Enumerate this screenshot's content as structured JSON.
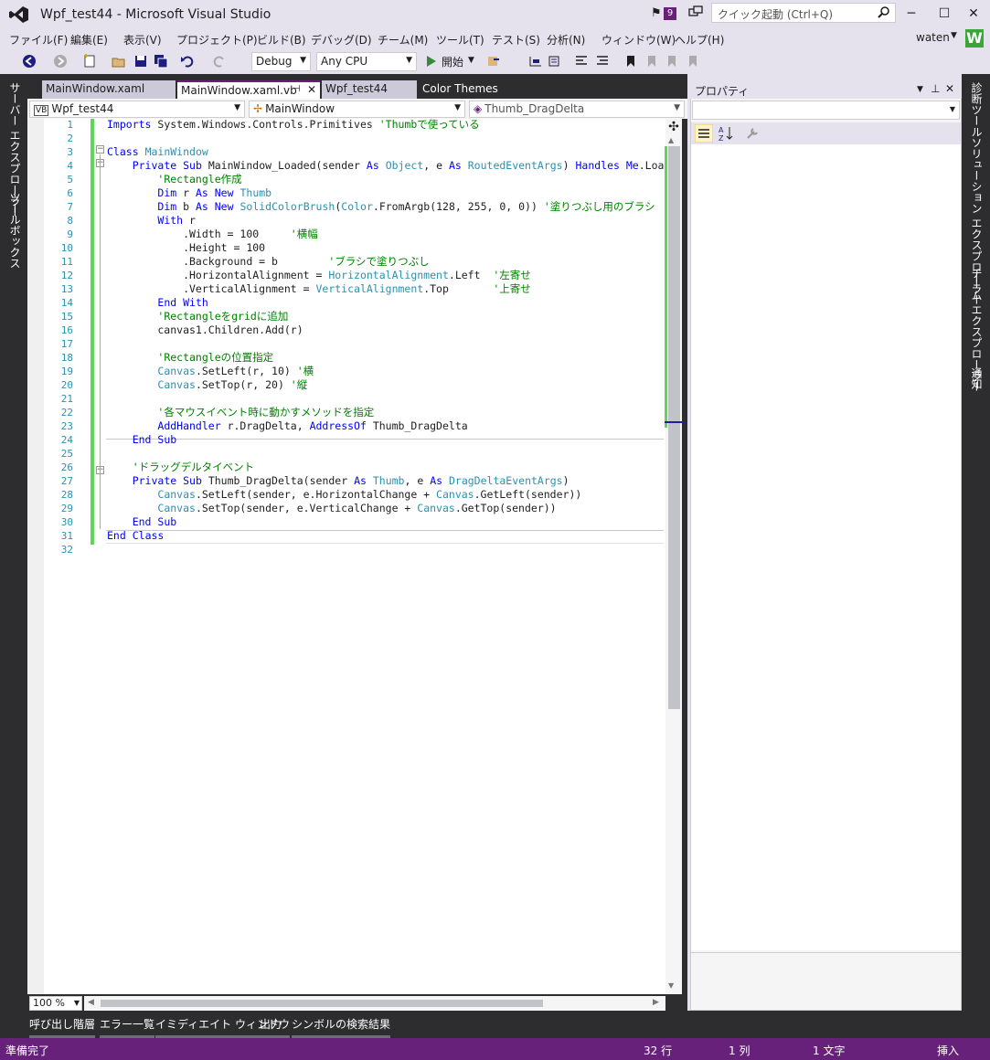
{
  "window": {
    "title": "Wpf_test44 - Microsoft Visual Studio",
    "notifications": "9",
    "quick_launch_placeholder": "クイック起動 (Ctrl+Q)",
    "minimize": "─",
    "maximize": "☐",
    "close": "✕"
  },
  "menu": [
    "ファイル(F)",
    "編集(E)",
    "表示(V)",
    "プロジェクト(P)",
    "ビルド(B)",
    "デバッグ(D)",
    "チーム(M)",
    "ツール(T)",
    "テスト(S)",
    "分析(N)",
    "ウィンドウ(W)",
    "ヘルプ(H)"
  ],
  "user": {
    "name": "waten",
    "avatar": "W"
  },
  "toolbar": {
    "config": "Debug",
    "platform": "Any CPU",
    "start": "開始"
  },
  "left_panels": [
    "サーバー エクスプローラー",
    "ツールボックス"
  ],
  "right_panels": [
    "診断ツール",
    "ソリューション エクスプローラー",
    "チーム エクスプローラー",
    "通知"
  ],
  "tabs": [
    {
      "label": "MainWindow.xaml"
    },
    {
      "label": "MainWindow.xaml.vb"
    },
    {
      "label": "Wpf_test44"
    },
    {
      "label": "Color Themes"
    }
  ],
  "nav": {
    "project": "Wpf_test44",
    "class": "MainWindow",
    "member": "Thumb_DragDelta"
  },
  "code": [
    {
      "n": "1",
      "text": "Imports System.Windows.Controls.Primitives 'Thumbで使っている"
    },
    {
      "n": "2",
      "text": ""
    },
    {
      "n": "3",
      "text": "Class MainWindow"
    },
    {
      "n": "4",
      "text": "    Private Sub MainWindow_Loaded(sender As Object, e As RoutedEventArgs) Handles Me.Loaded"
    },
    {
      "n": "5",
      "text": "        'Rectangle作成"
    },
    {
      "n": "6",
      "text": "        Dim r As New Thumb"
    },
    {
      "n": "7",
      "text": "        Dim b As New SolidColorBrush(Color.FromArgb(128, 255, 0, 0)) '塗りつぶし用のブラシ"
    },
    {
      "n": "8",
      "text": "        With r"
    },
    {
      "n": "9",
      "text": "            .Width = 100     '横幅"
    },
    {
      "n": "10",
      "text": "            .Height = 100"
    },
    {
      "n": "11",
      "text": "            .Background = b        'ブラシで塗りつぶし"
    },
    {
      "n": "12",
      "text": "            .HorizontalAlignment = HorizontalAlignment.Left  '左寄せ"
    },
    {
      "n": "13",
      "text": "            .VerticalAlignment = VerticalAlignment.Top       '上寄せ"
    },
    {
      "n": "14",
      "text": "        End With"
    },
    {
      "n": "15",
      "text": "        'Rectangleをgridに追加"
    },
    {
      "n": "16",
      "text": "        canvas1.Children.Add(r)"
    },
    {
      "n": "17",
      "text": ""
    },
    {
      "n": "18",
      "text": "        'Rectangleの位置指定"
    },
    {
      "n": "19",
      "text": "        Canvas.SetLeft(r, 10) '横"
    },
    {
      "n": "20",
      "text": "        Canvas.SetTop(r, 20) '縦"
    },
    {
      "n": "21",
      "text": ""
    },
    {
      "n": "22",
      "text": "        '各マウスイベント時に動かすメソッドを指定"
    },
    {
      "n": "23",
      "text": "        AddHandler r.DragDelta, AddressOf Thumb_DragDelta"
    },
    {
      "n": "24",
      "text": "    End Sub"
    },
    {
      "n": "25",
      "text": ""
    },
    {
      "n": "26",
      "text": "    'ドラッグデルタイベント"
    },
    {
      "n": "27",
      "text": "    Private Sub Thumb_DragDelta(sender As Thumb, e As DragDeltaEventArgs)"
    },
    {
      "n": "28",
      "text": "        Canvas.SetLeft(sender, e.HorizontalChange + Canvas.GetLeft(sender))"
    },
    {
      "n": "29",
      "text": "        Canvas.SetTop(sender, e.VerticalChange + Canvas.GetTop(sender))"
    },
    {
      "n": "30",
      "text": "    End Sub"
    },
    {
      "n": "31",
      "text": "End Class"
    },
    {
      "n": "32",
      "text": ""
    }
  ],
  "zoom": "100 %",
  "properties": {
    "title": "プロパティ"
  },
  "bottom_tabs": [
    "呼び出し階層",
    "エラー一覧",
    "イミディエイト ウィンドウ",
    "出力",
    "シンボルの検索結果"
  ],
  "status": {
    "ready": "準備完了",
    "line": "32 行",
    "col": "1 列",
    "char": "1 文字",
    "mode": "挿入"
  }
}
